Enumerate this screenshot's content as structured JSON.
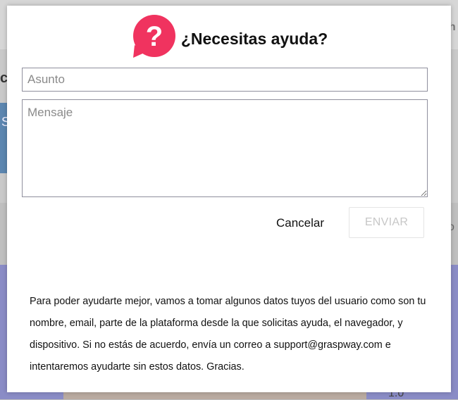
{
  "background": {
    "top_right_fragment": "ah",
    "left_fragment": "cr",
    "blue_tile_letter": "S",
    "right_fragment": "o",
    "bottom_number": "1.0"
  },
  "modal": {
    "title": "¿Necesitas ayuda?",
    "icon": "question-speech-bubble-icon",
    "icon_color": "#f0335f",
    "subject_placeholder": "Asunto",
    "subject_value": "",
    "message_placeholder": "Mensaje",
    "message_value": "",
    "cancel_label": "Cancelar",
    "send_label": "ENVIAR",
    "notice_text": "Para poder ayudarte mejor, vamos a tomar algunos datos tuyos del usuario como son tu nombre, email, parte de la plataforma desde la que solicitas ayuda, el navegador, y dispositivo. Si no estás de acuerdo, envía un correo a support@graspway.com e intentaremos ayudarte sin estos datos. Gracias."
  }
}
